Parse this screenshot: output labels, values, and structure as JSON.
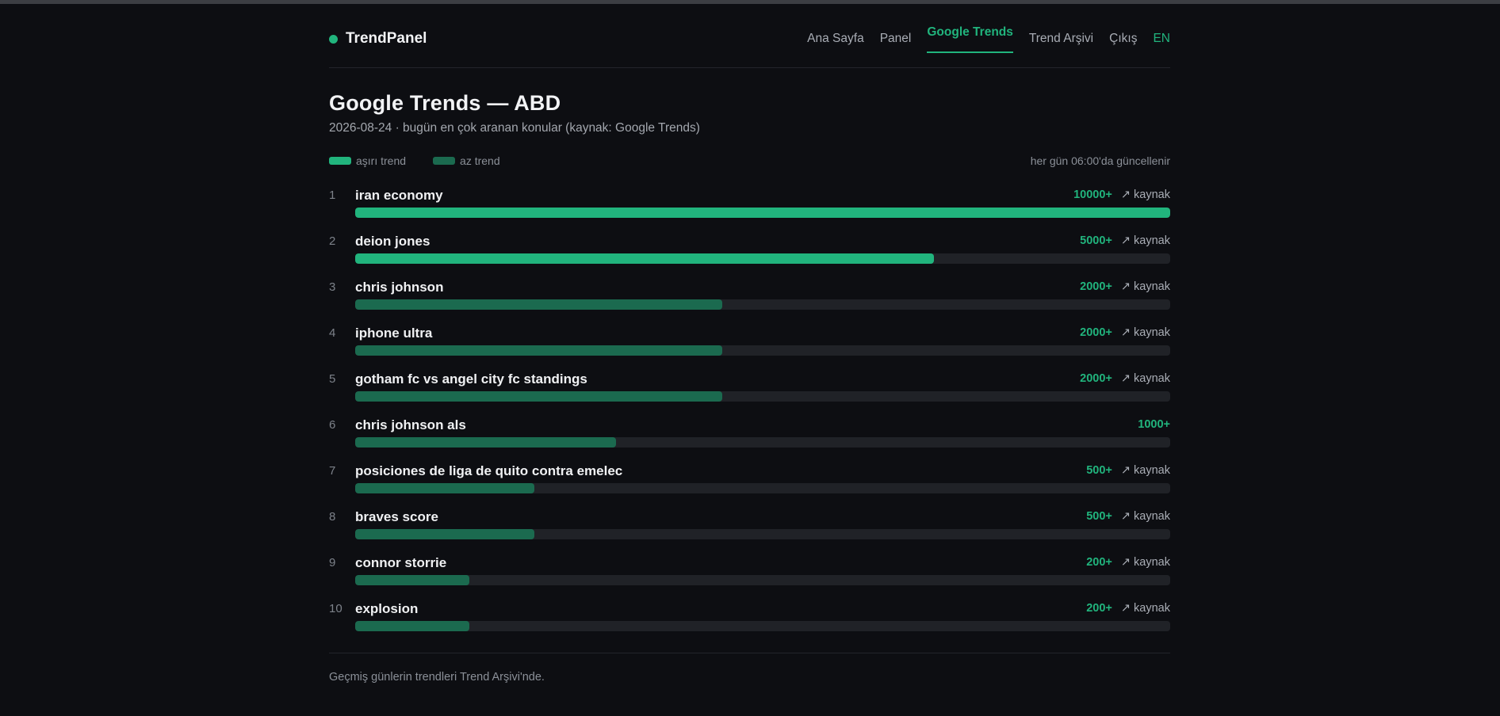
{
  "brand": {
    "name": "TrendPanel",
    "dot_color": "#21b47d"
  },
  "nav": {
    "items": [
      {
        "label": "Ana Sayfa",
        "active": false
      },
      {
        "label": "Panel",
        "active": false
      },
      {
        "label": "Google Trends",
        "active": true
      },
      {
        "label": "Trend Arşivi",
        "active": false
      },
      {
        "label": "Çıkış",
        "active": false
      }
    ],
    "lang": "EN"
  },
  "page": {
    "title": "Google Trends — ABD",
    "subtitle": "2026-08-24 · bugün en çok aranan konular (kaynak: Google Trends)"
  },
  "legend": {
    "high": {
      "label": "aşırı trend",
      "color": "#21b47d"
    },
    "low": {
      "label": "az trend",
      "color": "#1b6a4f"
    },
    "update_note": "her gün 06:00'da güncellenir"
  },
  "colors": {
    "accent": "#21b47d",
    "low_trend": "#1b6a4f",
    "track": "#202227",
    "background": "#0d0e12"
  },
  "trends": [
    {
      "rank": "1",
      "term": "iran economy",
      "volume": "10000+",
      "fill_pct": 100,
      "level": "high",
      "source": "↗ kaynak"
    },
    {
      "rank": "2",
      "term": "deion jones",
      "volume": "5000+",
      "fill_pct": 71,
      "level": "high",
      "source": "↗ kaynak"
    },
    {
      "rank": "3",
      "term": "chris johnson",
      "volume": "2000+",
      "fill_pct": 45,
      "level": "low",
      "source": "↗ kaynak"
    },
    {
      "rank": "4",
      "term": "iphone ultra",
      "volume": "2000+",
      "fill_pct": 45,
      "level": "low",
      "source": "↗ kaynak"
    },
    {
      "rank": "5",
      "term": "gotham fc vs angel city fc standings",
      "volume": "2000+",
      "fill_pct": 45,
      "level": "low",
      "source": "↗ kaynak"
    },
    {
      "rank": "6",
      "term": "chris johnson als",
      "volume": "1000+",
      "fill_pct": 32,
      "level": "low",
      "source": ""
    },
    {
      "rank": "7",
      "term": "posiciones de liga de quito contra emelec",
      "volume": "500+",
      "fill_pct": 22,
      "level": "low",
      "source": "↗ kaynak"
    },
    {
      "rank": "8",
      "term": "braves score",
      "volume": "500+",
      "fill_pct": 22,
      "level": "low",
      "source": "↗ kaynak"
    },
    {
      "rank": "9",
      "term": "connor storrie",
      "volume": "200+",
      "fill_pct": 14,
      "level": "low",
      "source": "↗ kaynak"
    },
    {
      "rank": "10",
      "term": "explosion",
      "volume": "200+",
      "fill_pct": 14,
      "level": "low",
      "source": "↗ kaynak"
    }
  ],
  "footer": {
    "text": "Geçmiş günlerin trendleri Trend Arşivi'nde."
  }
}
